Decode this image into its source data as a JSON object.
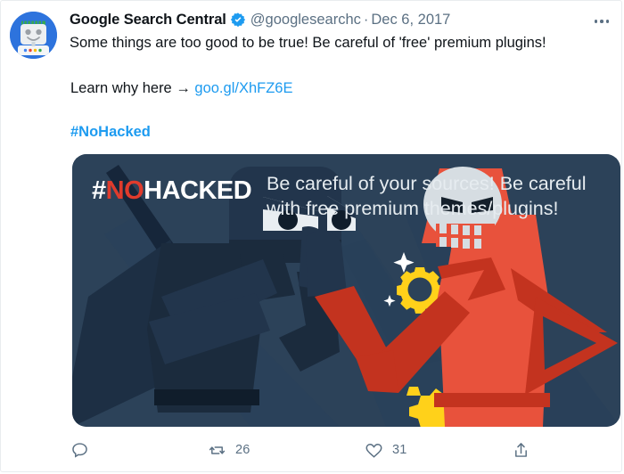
{
  "post": {
    "author": {
      "display_name": "Google Search Central",
      "handle": "@googlesearchc",
      "verified": true,
      "verified_icon": "verified-badge-icon",
      "avatar_icon": "robot-avatar-icon"
    },
    "separator": "·",
    "date": "Dec 6, 2017",
    "more_icon": "more-options-icon",
    "text": "Some things are too good to be true! Be careful of 'free' premium plugins!",
    "link_line": {
      "prefix": "Learn why here → ",
      "link_text": "goo.gl/XhFZ6E"
    },
    "hashtag": "#NoHacked"
  },
  "media": {
    "alt_name": "nohacked-illustration",
    "badge": {
      "hash": "#",
      "highlight": "NO",
      "rest": "HACKED"
    },
    "headline_line_1": "Be careful of your sources! Be careful",
    "headline_line_2": "with free premium themes/plugins!",
    "characters": [
      "ninja-figure",
      "skeleton-figure",
      "gear-icon",
      "sparkles"
    ]
  },
  "actions": [
    {
      "name": "reply",
      "icon": "reply-icon",
      "count": ""
    },
    {
      "name": "retweet",
      "icon": "retweet-icon",
      "count": "26"
    },
    {
      "name": "like",
      "icon": "like-heart-icon",
      "count": "31"
    },
    {
      "name": "share",
      "icon": "share-icon",
      "count": ""
    }
  ],
  "colors": {
    "link_blue": "#1d9bf0",
    "verified_blue": "#1d9bf0",
    "text_primary": "#0f1419",
    "text_secondary": "#5b7083",
    "card_border": "#e9ecef",
    "media_bg": "#2c4259",
    "media_bg_shadow": "#253a4f",
    "badge_red": "#e03b2c",
    "skeleton_red": "#e8523c",
    "skeleton_red_dark": "#c3331f",
    "skull_white": "#d6dde2",
    "gear_yellow": "#ffd11a",
    "ninja_dark": "#1b2b3d"
  }
}
